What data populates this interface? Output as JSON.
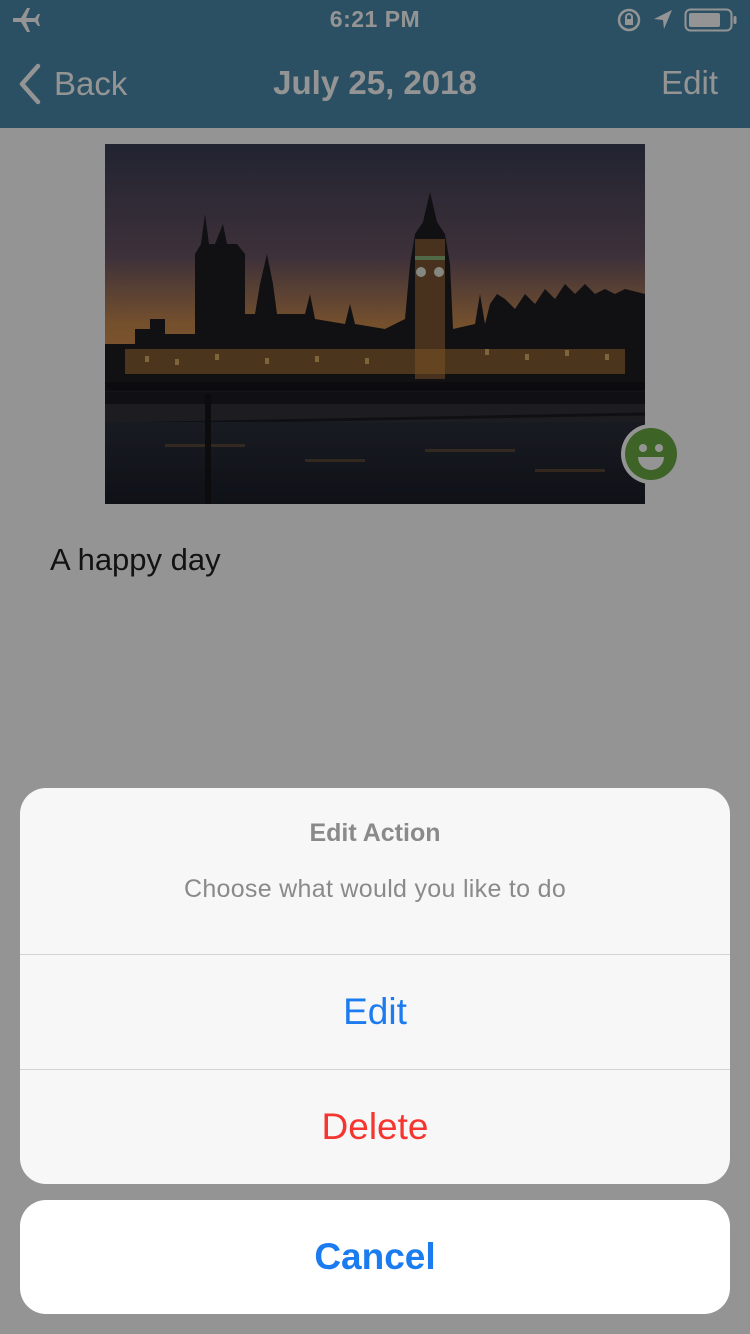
{
  "status_bar": {
    "time": "6:21 PM",
    "left_icon": "airplane-icon",
    "right_icons": [
      "rotation-lock-icon",
      "location-arrow-icon",
      "battery-icon"
    ]
  },
  "nav_bar": {
    "back_label": "Back",
    "title": "July 25, 2018",
    "edit_label": "Edit",
    "background_color": "#4a8bad"
  },
  "entry": {
    "photo_icon": "city-skyline-photo",
    "mood_icon": "smiley-face-icon",
    "text": "A happy day"
  },
  "action_sheet": {
    "title": "Edit Action",
    "message": "Choose what would you like to do",
    "edit_label": "Edit",
    "delete_label": "Delete",
    "cancel_label": "Cancel",
    "accent_color": "#1b7cf0",
    "destructive_color": "#f5352f"
  }
}
